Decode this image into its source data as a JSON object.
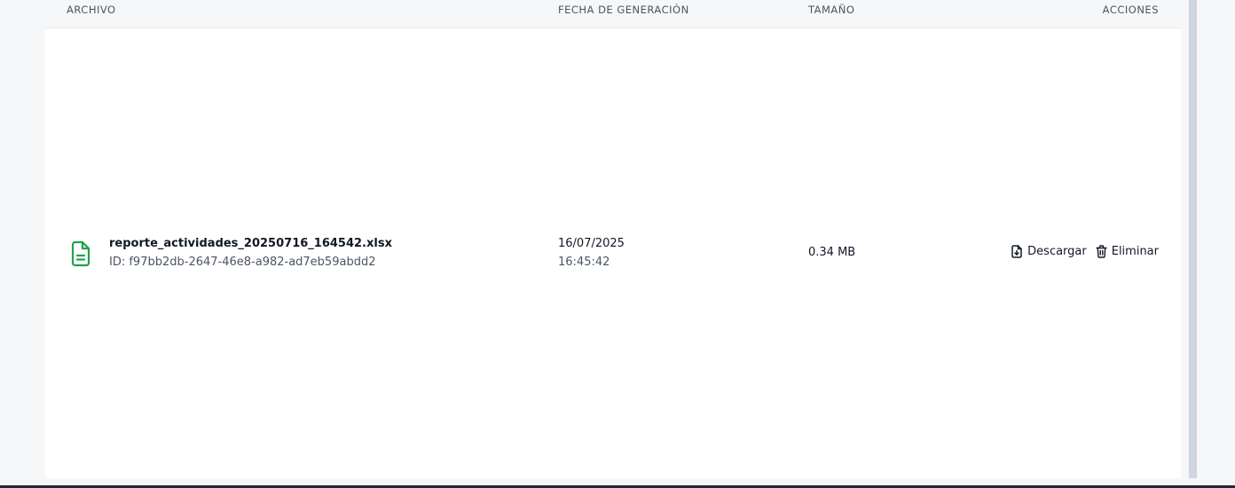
{
  "table": {
    "headers": {
      "archivo": "ARCHIVO",
      "fecha": "FECHA DE GENERACIÓN",
      "tamano": "TAMAÑO",
      "acciones": "ACCIONES"
    },
    "rows": [
      {
        "icon": "file-spreadsheet-icon",
        "file_name": "reporte_actividades_20250716_164542.xlsx",
        "id_label": "ID: f97bb2db-2647-46e8-a982-ad7eb59abdd2",
        "date": "16/07/2025",
        "time": "16:45:42",
        "size": "0.34 MB",
        "actions": {
          "download_label": "Descargar",
          "delete_label": "Eliminar"
        }
      }
    ]
  },
  "colors": {
    "file_icon": "#22a34a",
    "header_bg": "#f6f7f9",
    "card_bg": "#ffffff",
    "scrollbar": "#cfd5dd"
  }
}
